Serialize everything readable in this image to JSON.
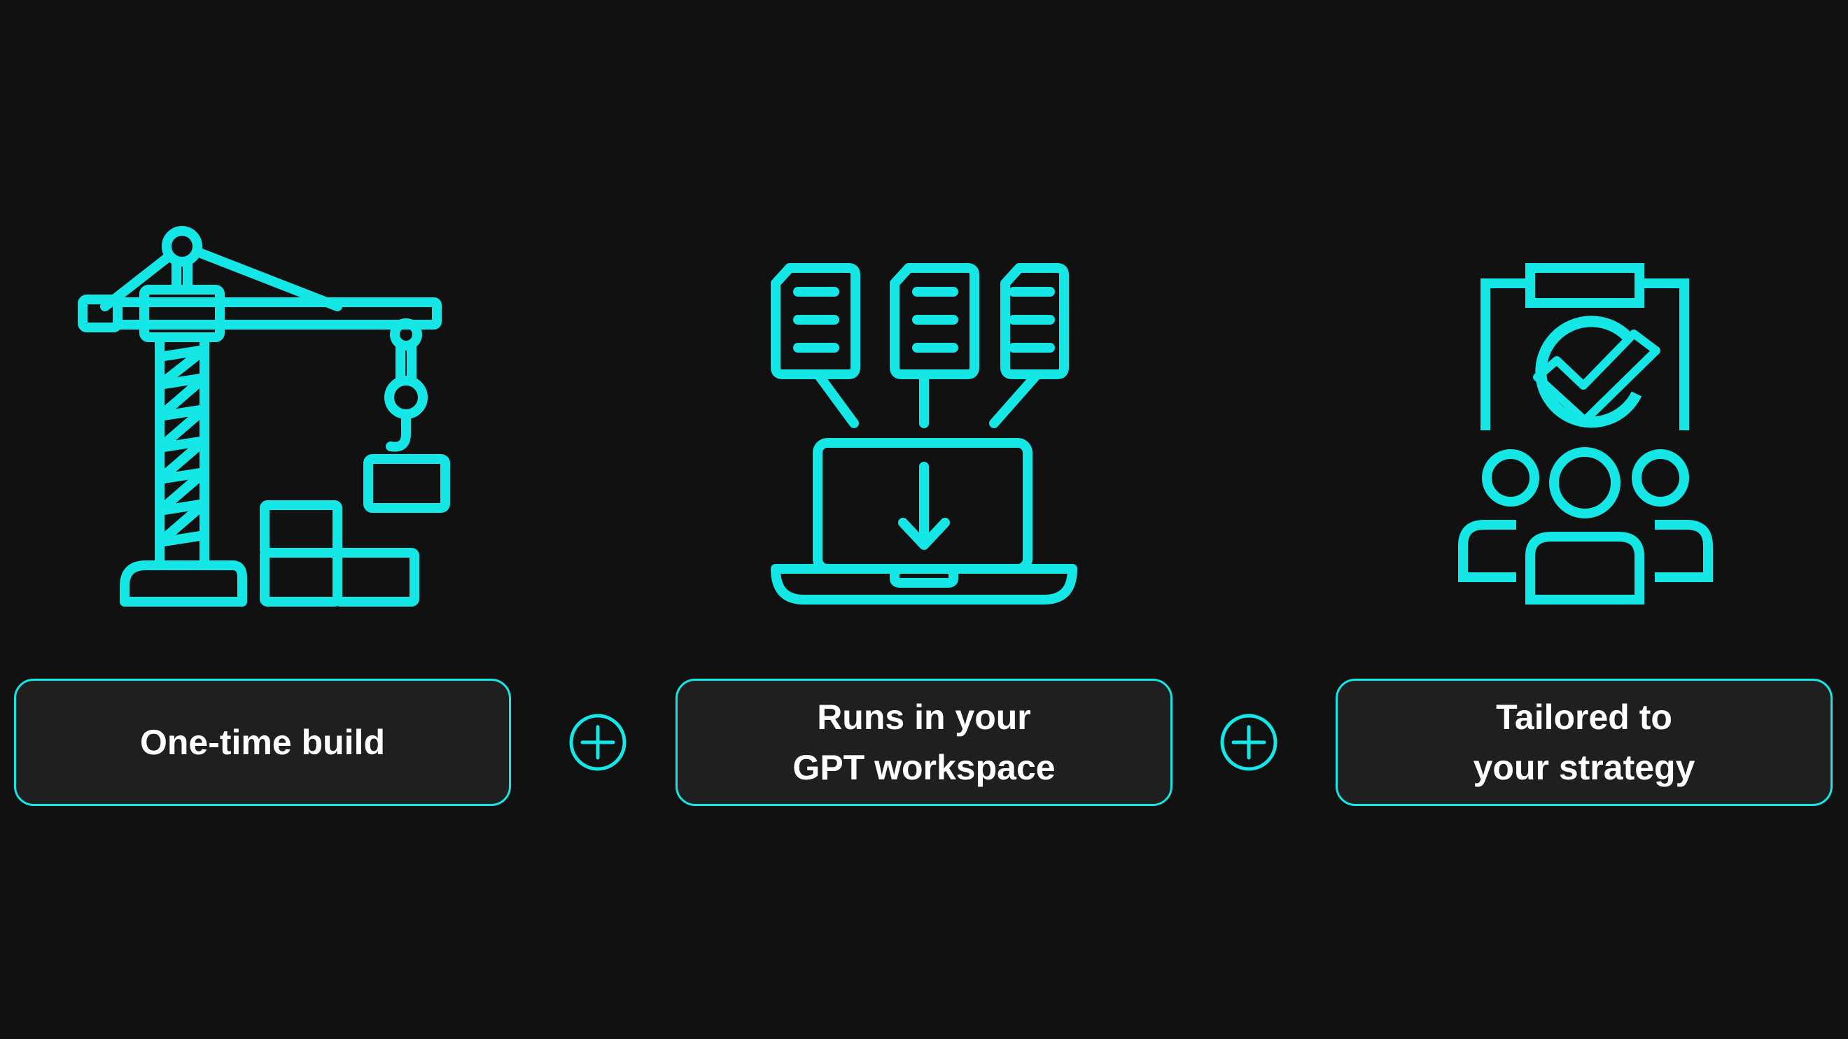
{
  "theme": {
    "background": "#111111",
    "accent": "#15e6e6",
    "card_background": "#1f1f1f",
    "text": "#ffffff"
  },
  "features": [
    {
      "icon": "tower-crane-icon",
      "label_lines": [
        "One-time build"
      ]
    },
    {
      "icon": "documents-to-laptop-icon",
      "label_lines": [
        "Runs in your",
        "GPT workspace"
      ]
    },
    {
      "icon": "clipboard-team-check-icon",
      "label_lines": [
        "Tailored to",
        "your strategy"
      ]
    }
  ],
  "separators": [
    {
      "icon": "plus-circle-icon"
    },
    {
      "icon": "plus-circle-icon"
    }
  ]
}
